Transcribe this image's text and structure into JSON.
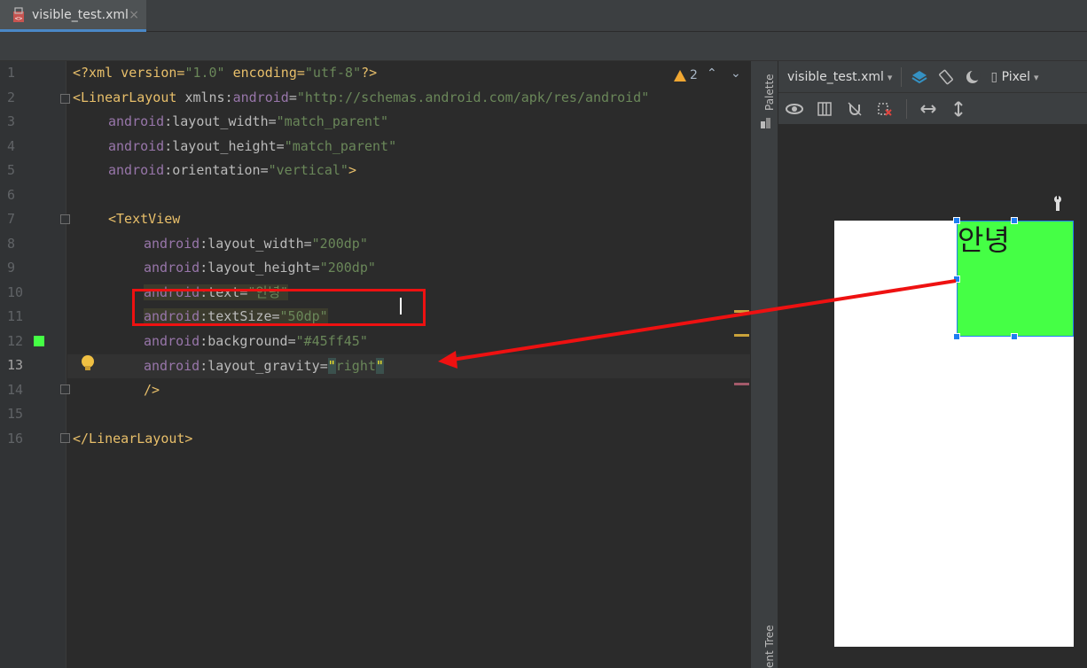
{
  "tab": {
    "label": "visible_test.xml",
    "close": "×"
  },
  "editor": {
    "line_numbers": [
      "1",
      "2",
      "3",
      "4",
      "5",
      "6",
      "7",
      "8",
      "9",
      "10",
      "11",
      "12",
      "13",
      "14",
      "15",
      "16"
    ],
    "warning_count": "2",
    "nav_up": "⌃",
    "nav_down": "⌄",
    "lines": {
      "l1": {
        "a": "<?xml version=",
        "b": "\"1.0\"",
        "c": " encoding=",
        "d": "\"utf-8\"",
        "e": "?>"
      },
      "l2": {
        "a": "<LinearLayout ",
        "b": "xmlns:",
        "c": "android",
        "d": "=",
        "e": "\"http://schemas.android.com/apk/res/android\""
      },
      "l3": {
        "ns": "android",
        "name": ":layout_width",
        "eq": "=",
        "val": "\"match_parent\""
      },
      "l4": {
        "ns": "android",
        "name": ":layout_height",
        "eq": "=",
        "val": "\"match_parent\""
      },
      "l5": {
        "ns": "android",
        "name": ":orientation",
        "eq": "=",
        "val": "\"vertical\"",
        "end": ">"
      },
      "l7": {
        "tag": "<TextView"
      },
      "l8": {
        "ns": "android",
        "name": ":layout_width",
        "eq": "=",
        "val": "\"200dp\""
      },
      "l9": {
        "ns": "android",
        "name": ":layout_height",
        "eq": "=",
        "val": "\"200dp\""
      },
      "l10": {
        "ns": "android",
        "name": ":text",
        "eq": "=",
        "val": "\"안녕\""
      },
      "l11": {
        "ns": "android",
        "name": ":textSize",
        "eq": "=",
        "val": "\"50dp\""
      },
      "l12": {
        "ns": "android",
        "name": ":background",
        "eq": "=",
        "val": "\"#45ff45\""
      },
      "l13": {
        "ns": "android",
        "name": ":layout_gravity",
        "eq": "=",
        "q1": "\"",
        "val": "right",
        "q2": "\""
      },
      "l14": {
        "tag": "/>"
      },
      "l16": {
        "tag": "</LinearLayout>"
      }
    }
  },
  "side_panel": {
    "palette": "Palette",
    "component_tree": "ent Tree"
  },
  "design": {
    "file_label": "visible_test.xml",
    "device_label": "Pixel",
    "preview_text": "안녕",
    "preview_background": "#45ff45"
  },
  "colors": {
    "highlight_box": "#ee1111",
    "selection": "#1e7ef2"
  }
}
